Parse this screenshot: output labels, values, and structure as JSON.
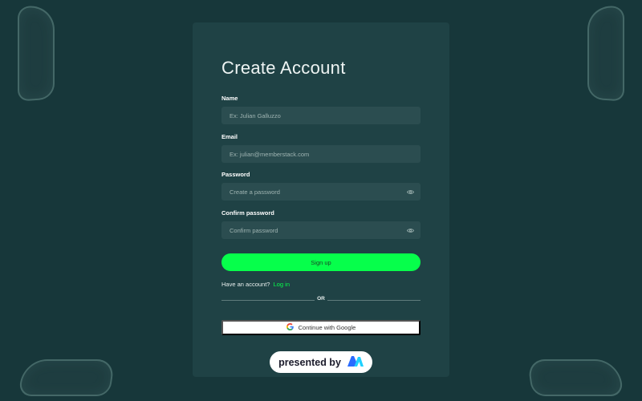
{
  "form": {
    "title": "Create Account",
    "fields": [
      {
        "label": "Name",
        "placeholder": "Ex: Julian Galluzzo",
        "has_eye": false
      },
      {
        "label": "Email",
        "placeholder": "Ex: julian@memberstack.com",
        "has_eye": false
      },
      {
        "label": "Password",
        "placeholder": "Create a password",
        "has_eye": true,
        "icon": "eye-icon"
      },
      {
        "label": "Confirm password",
        "placeholder": "Confirm password",
        "has_eye": true,
        "icon": "eye-icon"
      }
    ],
    "signup_label": "Sign up",
    "have_account_text": "Have an account?",
    "login_label": "Log in",
    "or_text": "OR",
    "google_label": "Continue with Google",
    "google_icon": "google-icon"
  },
  "badge": {
    "text": "presented by",
    "logo_icon": "memberstack-logo-icon"
  },
  "colors": {
    "background": "#17373a",
    "card": "#1f4245",
    "input": "#2b4d50",
    "accent": "#06ff4b",
    "login_link": "#06ff4b"
  }
}
